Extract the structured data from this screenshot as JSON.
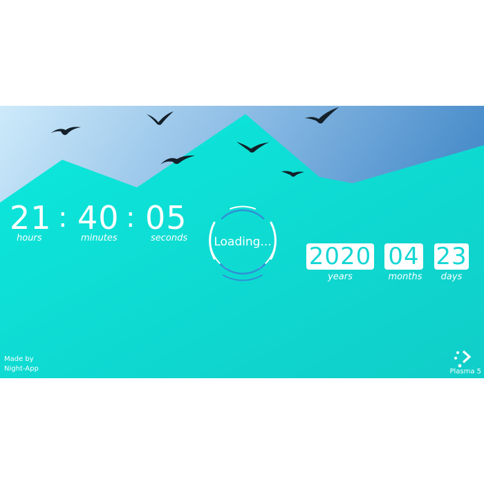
{
  "clock": {
    "hours": "21",
    "minutes": "40",
    "seconds": "05",
    "separator": ":",
    "hours_label": "hours",
    "minutes_label": "minutes",
    "seconds_label": "seconds"
  },
  "loader": {
    "text": "Loading..."
  },
  "date": {
    "year": "2020",
    "month": "04",
    "day": "23",
    "year_label": "years",
    "month_label": "months",
    "day_label": "days"
  },
  "credit": {
    "line1": "Made by",
    "line2": "Night-App"
  },
  "brand": {
    "label": "Plasma 5"
  },
  "theme": {
    "sky_light": "#cdeafa",
    "sky_dark": "#3f85c6",
    "ground_light": "#0ce9dd",
    "ground_dark": "#11cbc6",
    "text": "#ffffff",
    "ring_white": "#ffffff",
    "ring_blue": "#2f8fd6",
    "bird": "#14202a"
  }
}
